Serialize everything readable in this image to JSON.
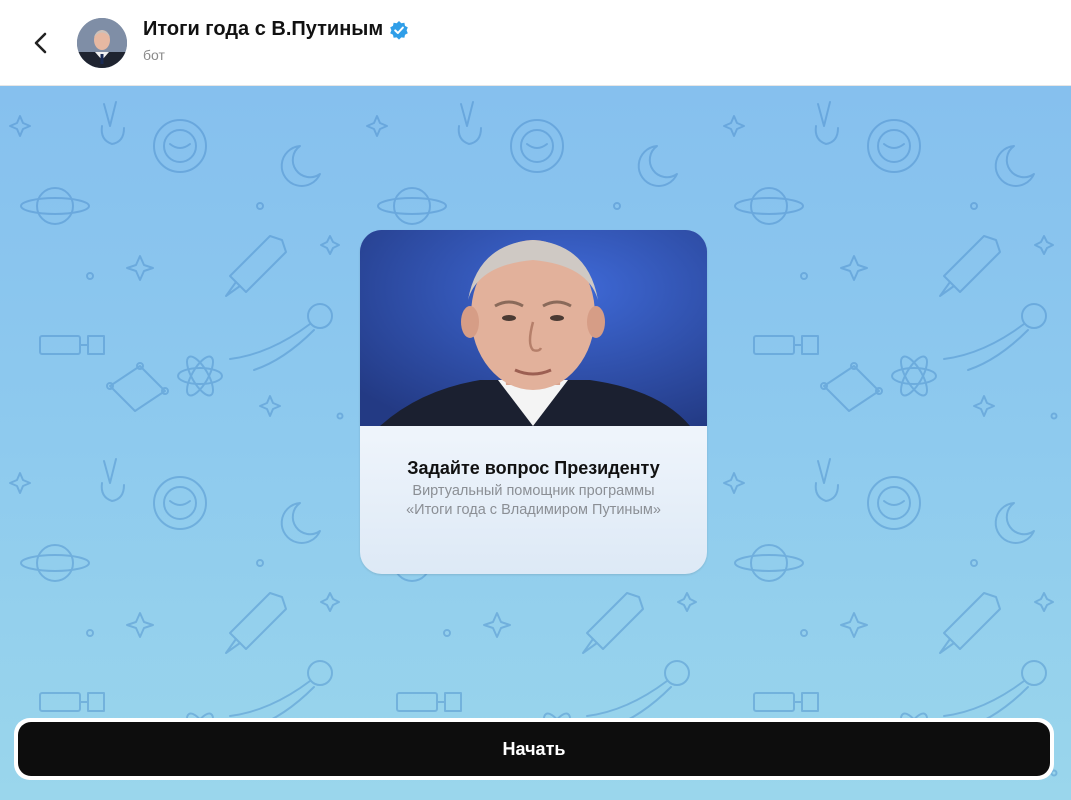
{
  "header": {
    "title": "Итоги года с В.Путиным",
    "subtitle": "бот",
    "icons": {
      "back": "chevron-left-icon",
      "verified": "verified-badge-icon",
      "avatar": "avatar"
    }
  },
  "card": {
    "title": "Задайте вопрос Президенту",
    "description": "Виртуальный помощник программы «Итоги года с Владимиром Путиным»"
  },
  "actions": {
    "start_label": "Начать"
  },
  "colors": {
    "verified": "#2f9ee8",
    "chat_background": "#8dc9ee",
    "button": "#0d0d0d"
  }
}
